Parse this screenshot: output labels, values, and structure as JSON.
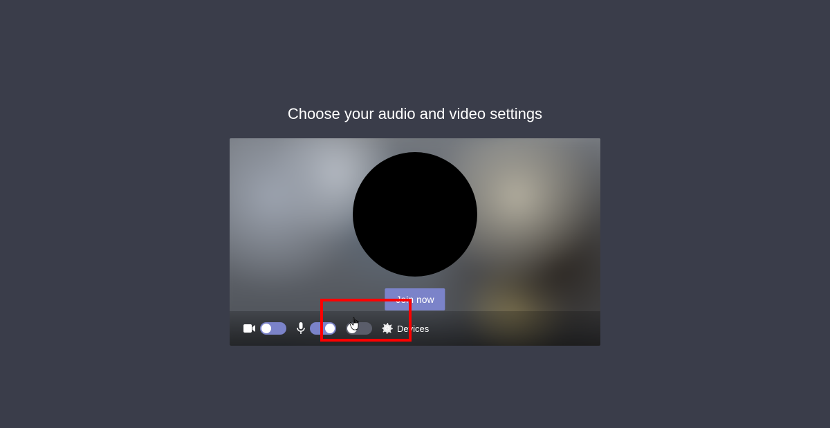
{
  "heading": "Choose your audio and video settings",
  "join_button_label": "Join now",
  "controls": {
    "camera": {
      "icon": "camera-icon",
      "on": true
    },
    "microphone": {
      "icon": "microphone-icon",
      "on": true
    },
    "effects": {
      "icon": "effects-icon",
      "on": false
    },
    "devices_label": "Devices"
  },
  "highlight": {
    "target": "microphone-toggle",
    "color": "#ff0000"
  }
}
